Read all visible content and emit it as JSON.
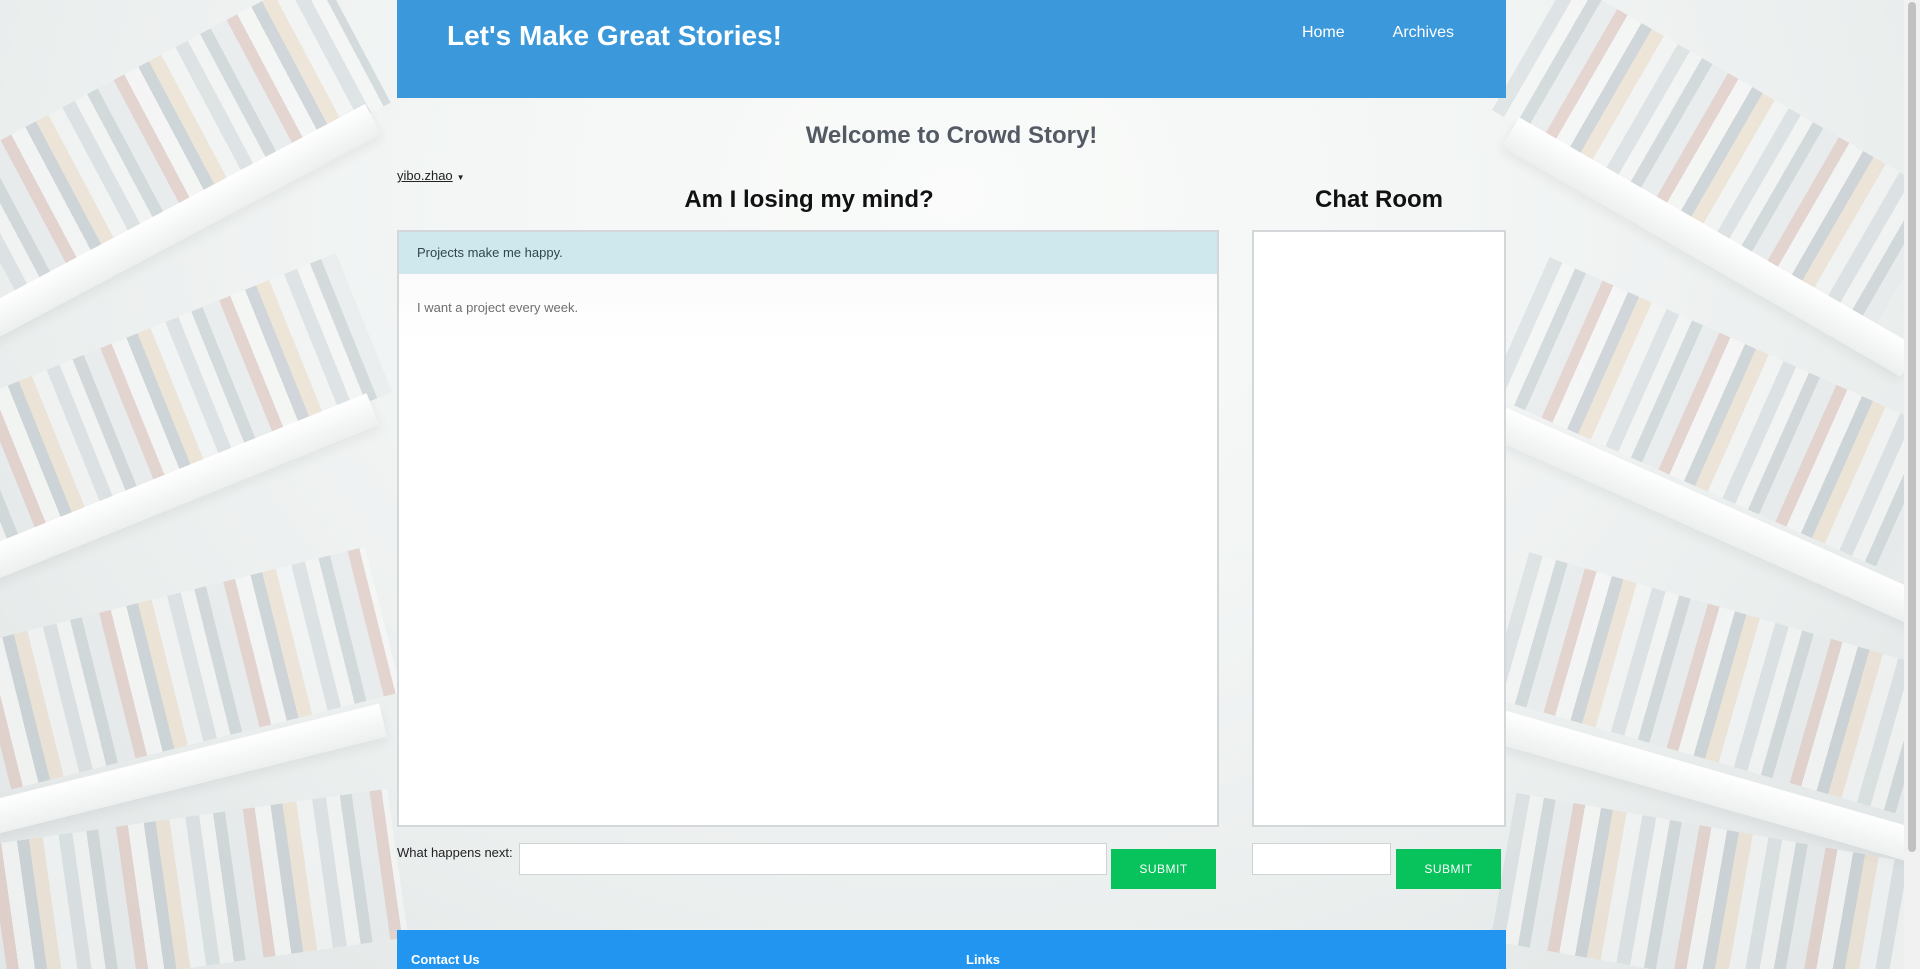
{
  "header": {
    "site_title": "Let's Make Great Stories!",
    "nav": {
      "home": "Home",
      "archives": "Archives"
    }
  },
  "welcome": "Welcome to Crowd Story!",
  "user": {
    "name": "yibo.zhao",
    "caret": "▼"
  },
  "story": {
    "title": "Am I losing my mind?",
    "lines": [
      "Projects make me happy.",
      "I want a project every week."
    ],
    "next_label": "What happens next:",
    "next_value": "",
    "submit_label": "SUBMIT"
  },
  "chat": {
    "title": "Chat Room",
    "input_value": "",
    "submit_label": "SUBMIT"
  },
  "footer": {
    "contact": "Contact Us",
    "links": "Links"
  },
  "colors": {
    "header_bg": "#3a98db",
    "footer_bg": "#2195ef",
    "submit_bg": "#08c35b",
    "highlight_line_bg": "#cfe8ee"
  }
}
